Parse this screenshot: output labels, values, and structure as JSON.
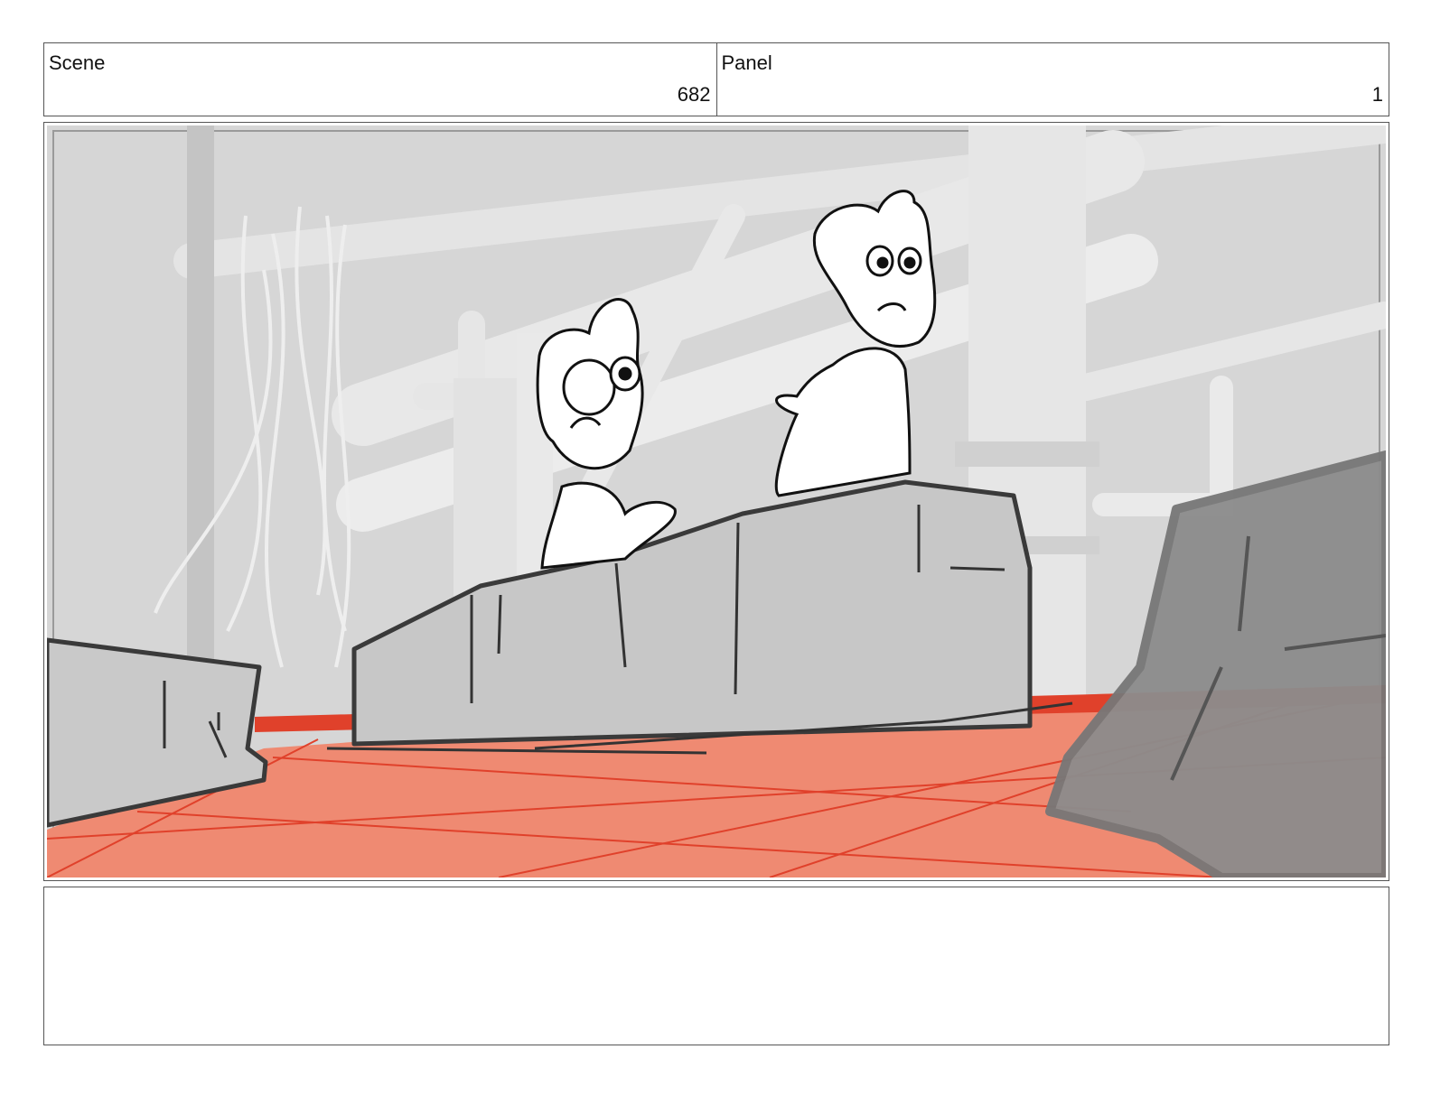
{
  "header": {
    "scene_label": "Scene",
    "scene_number": "682",
    "panel_label": "Panel",
    "panel_number": "1"
  },
  "colors": {
    "floor": "#ef8a72",
    "floor_lines": "#e0412b",
    "block": "#c7c7c7",
    "foreground_block": "#8c8c8c",
    "background": "#dcdcdc"
  },
  "notes": {
    "text": ""
  }
}
